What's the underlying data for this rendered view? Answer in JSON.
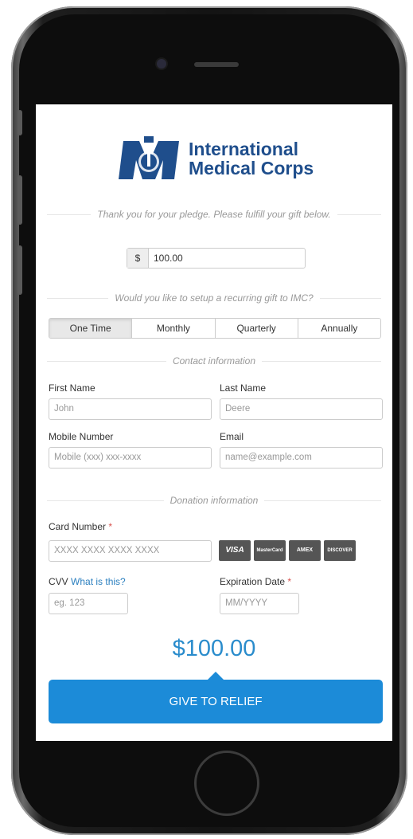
{
  "logo": {
    "line1": "International",
    "line2": "Medical Corps"
  },
  "intro_text": "Thank you for your pledge. Please fulfill your gift below.",
  "amount": {
    "currency": "$",
    "value": "100.00"
  },
  "recurring_prompt": "Would you like to setup a recurring gift to IMC?",
  "frequency": {
    "options": [
      "One Time",
      "Monthly",
      "Quarterly",
      "Annually"
    ],
    "selected": "One Time"
  },
  "contact_heading": "Contact information",
  "contact": {
    "first_name": {
      "label": "First Name",
      "placeholder": "John"
    },
    "last_name": {
      "label": "Last Name",
      "placeholder": "Deere"
    },
    "mobile": {
      "label": "Mobile Number",
      "placeholder": "Mobile (xxx) xxx-xxxx"
    },
    "email": {
      "label": "Email",
      "placeholder": "name@example.com"
    }
  },
  "donation_heading": "Donation information",
  "donation": {
    "card_number": {
      "label": "Card Number",
      "required": "*",
      "placeholder": "XXXX XXXX XXXX XXXX"
    },
    "cards": [
      "VISA",
      "MasterCard",
      "AMEX",
      "DISCOVER"
    ],
    "cvv": {
      "label": "CVV",
      "help_link": "What is this?",
      "placeholder": "eg. 123"
    },
    "expiration": {
      "label": "Expiration Date",
      "required": "*",
      "placeholder": "MM/YYYY"
    }
  },
  "total": "$100.00",
  "submit_label": "GIVE TO RELIEF",
  "colors": {
    "brand_blue": "#1f4e8c",
    "accent": "#1c8bd8",
    "total": "#2a8ccc",
    "required": "#d9534f"
  }
}
